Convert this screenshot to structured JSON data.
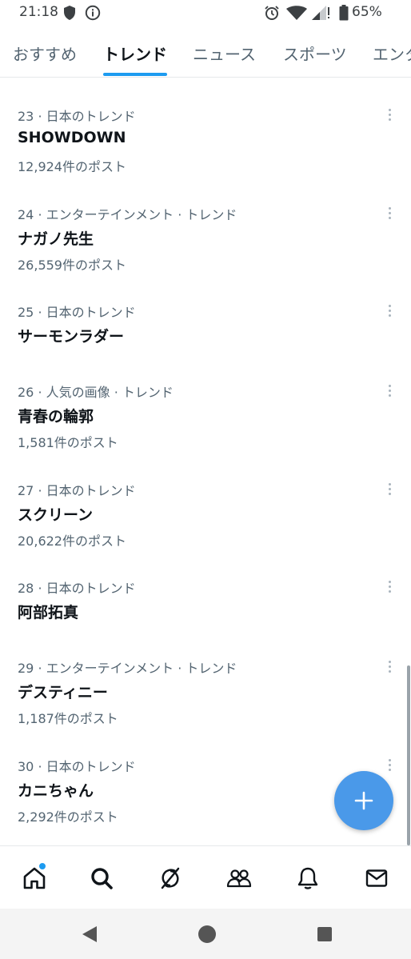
{
  "status_bar": {
    "time": "21:18",
    "battery": "65%",
    "icons": [
      "shield-icon",
      "info-icon",
      "alarm-icon",
      "wifi-icon",
      "signal-icon",
      "battery-icon"
    ]
  },
  "tabs": [
    {
      "label": "おすすめ",
      "active": false
    },
    {
      "label": "トレンド",
      "active": true
    },
    {
      "label": "ニュース",
      "active": false
    },
    {
      "label": "スポーツ",
      "active": false
    },
    {
      "label": "エンタ",
      "active": false
    }
  ],
  "trends": [
    {
      "meta": "23 · 日本のトレンド",
      "name": "SHOWDOWN",
      "count": "12,924件のポスト"
    },
    {
      "meta": "24 · エンターテインメント · トレンド",
      "name": "ナガノ先生",
      "count": "26,559件のポスト"
    },
    {
      "meta": "25 · 日本のトレンド",
      "name": "サーモンラダー",
      "count": ""
    },
    {
      "meta": "26 · 人気の画像 · トレンド",
      "name": "青春の輪郭",
      "count": "1,581件のポスト"
    },
    {
      "meta": "27 · 日本のトレンド",
      "name": "スクリーン",
      "count": "20,622件のポスト"
    },
    {
      "meta": "28 · 日本のトレンド",
      "name": "阿部拓真",
      "count": ""
    },
    {
      "meta": "29 · エンターテインメント · トレンド",
      "name": "デスティニー",
      "count": "1,187件のポスト"
    },
    {
      "meta": "30 · 日本のトレンド",
      "name": "カニちゃん",
      "count": "2,292件のポスト"
    }
  ],
  "fab": {
    "icon": "plus-icon",
    "color": "#4a99e9"
  },
  "bottom_nav": [
    "home-icon",
    "search-icon",
    "grok-icon",
    "communities-icon",
    "notifications-icon",
    "messages-icon"
  ],
  "android_nav": [
    "back-icon",
    "home-circle-icon",
    "recents-icon"
  ],
  "colors": {
    "accent": "#1d9bf0",
    "text": "#0f1419",
    "secondary": "#536471"
  }
}
